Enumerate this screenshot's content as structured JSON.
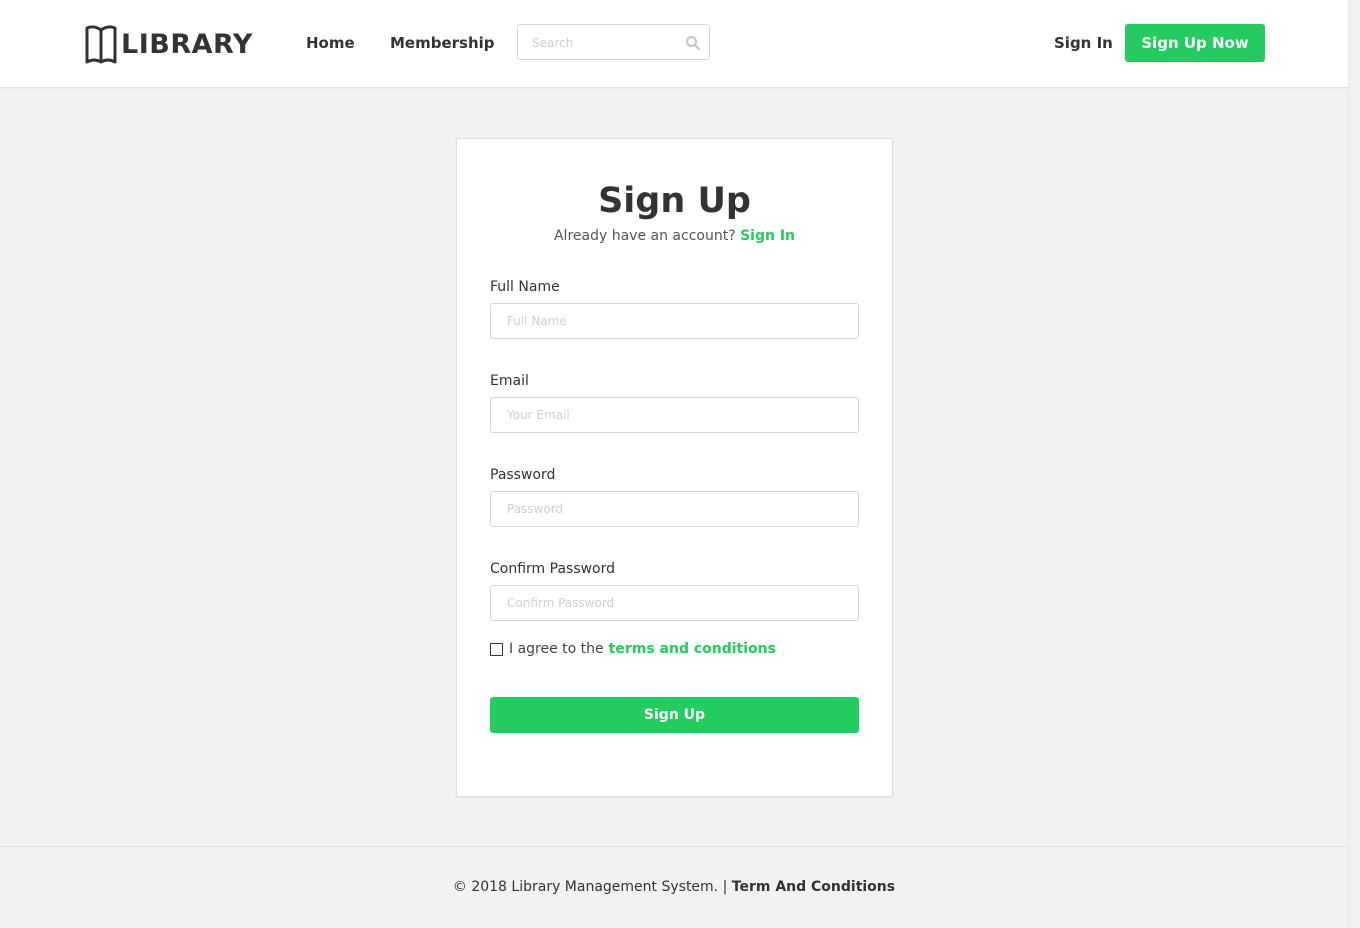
{
  "brand": {
    "name": "LIBRARY",
    "logo_icon": "open-book-icon",
    "accent_color": "#22cc5e",
    "text_color": "#333333"
  },
  "nav": {
    "items": [
      {
        "label": "Home"
      },
      {
        "label": "Membership"
      }
    ],
    "search": {
      "placeholder": "Search",
      "value": "",
      "icon": "search-icon"
    },
    "signin_label": "Sign In",
    "signup_label": "Sign Up Now"
  },
  "form": {
    "title": "Sign Up",
    "subtitle_prefix": "Already have an account?",
    "subtitle_link": "Sign In",
    "fields": [
      {
        "label": "Full Name",
        "placeholder": "Full Name",
        "value": ""
      },
      {
        "label": "Email",
        "placeholder": "Your Email",
        "value": ""
      },
      {
        "label": "Password",
        "placeholder": "Password",
        "value": ""
      },
      {
        "label": "Confirm Password",
        "placeholder": "Confirm Password",
        "value": ""
      }
    ],
    "agree_prefix": "I agree to the",
    "agree_link": "terms and conditions",
    "agree_checked": false,
    "submit_label": "Sign Up"
  },
  "footer": {
    "copyright": "© 2018 Library Management System. |",
    "link": "Term And Conditions"
  }
}
